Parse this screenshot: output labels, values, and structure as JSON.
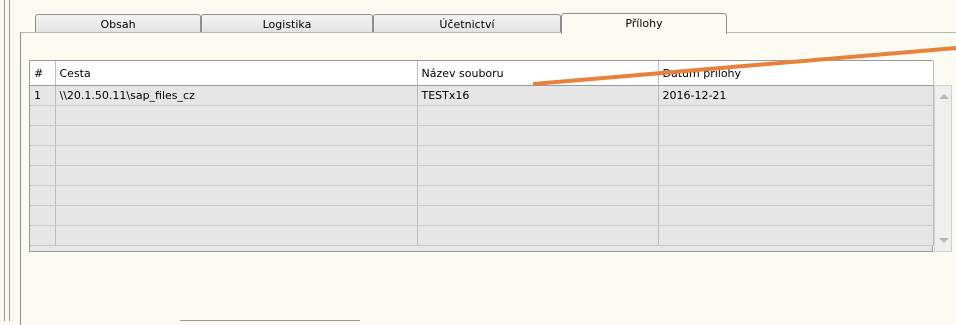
{
  "tabs": [
    {
      "label": "Obsah",
      "active": false
    },
    {
      "label": "Logistika",
      "active": false
    },
    {
      "label": "Účetnictví",
      "active": false
    },
    {
      "label": "Přílohy",
      "active": true
    }
  ],
  "table": {
    "columns": [
      "#",
      "Cesta",
      "Název souboru",
      "Datum přílohy"
    ],
    "rows": [
      [
        "1",
        "\\\\20.1.50.11\\sap_files_cz",
        "TESTx16",
        "2016-12-21"
      ],
      [
        "",
        "",
        "",
        ""
      ],
      [
        "",
        "",
        "",
        ""
      ],
      [
        "",
        "",
        "",
        ""
      ],
      [
        "",
        "",
        "",
        ""
      ],
      [
        "",
        "",
        "",
        ""
      ],
      [
        "",
        "",
        "",
        ""
      ],
      [
        "",
        "",
        "",
        ""
      ]
    ]
  },
  "colors": {
    "annotation_line": "#e8823a",
    "background": "#fbfbf2"
  },
  "icons": [
    "scroll-up-icon",
    "scroll-down-icon"
  ]
}
